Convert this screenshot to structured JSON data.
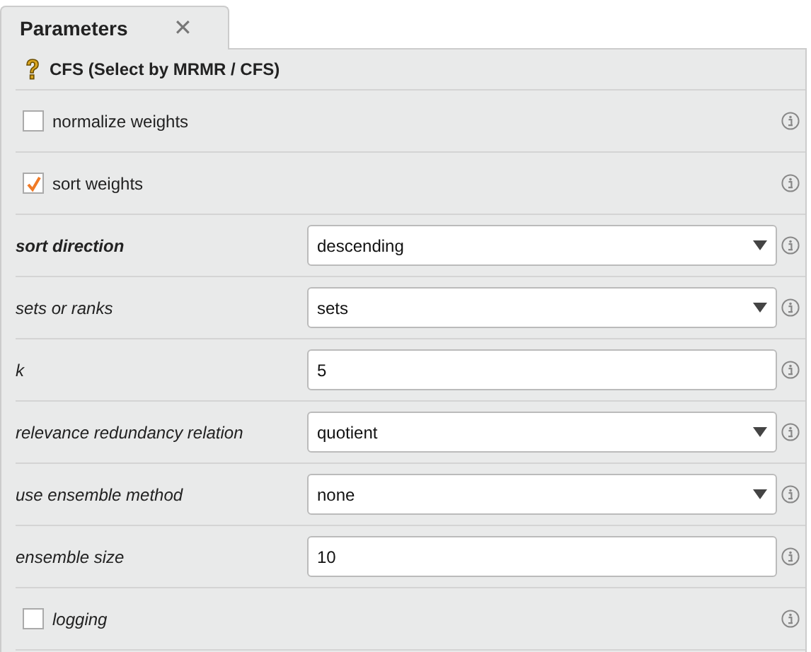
{
  "tab": {
    "title": "Parameters",
    "close": "✕"
  },
  "operator": {
    "title": "CFS (Select by MRMR / CFS)"
  },
  "params": [
    {
      "kind": "checkbox",
      "label": "normalize weights",
      "checked": false,
      "italic": false,
      "bold": false
    },
    {
      "kind": "checkbox",
      "label": "sort weights",
      "checked": true,
      "italic": false,
      "bold": false
    },
    {
      "kind": "select",
      "label": "sort direction",
      "value": "descending",
      "italic": true,
      "bold": true
    },
    {
      "kind": "select",
      "label": "sets or ranks",
      "value": "sets",
      "italic": true,
      "bold": false
    },
    {
      "kind": "text",
      "label": "k",
      "value": "5",
      "italic": true,
      "bold": false
    },
    {
      "kind": "select",
      "label": "relevance redundancy relation",
      "value": "quotient",
      "italic": true,
      "bold": false
    },
    {
      "kind": "select",
      "label": "use ensemble method",
      "value": "none",
      "italic": true,
      "bold": false
    },
    {
      "kind": "text",
      "label": "ensemble size",
      "value": "10",
      "italic": true,
      "bold": false
    },
    {
      "kind": "checkbox",
      "label": "logging",
      "checked": false,
      "italic": true,
      "bold": false
    }
  ]
}
